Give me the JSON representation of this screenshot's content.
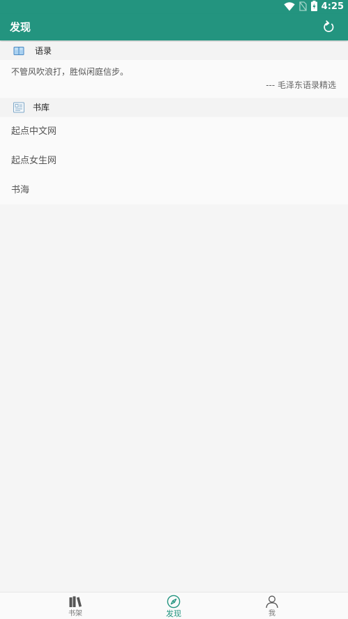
{
  "status_bar": {
    "time": "4:25",
    "icons": [
      "wifi-icon",
      "no-sim-icon",
      "battery-charging-icon"
    ]
  },
  "toolbar": {
    "title": "发现",
    "refresh_icon": "refresh-icon"
  },
  "quotes_section": {
    "label": "语录",
    "icon": "book-open-icon",
    "quote": "不管风吹浪打，胜似闲庭信步。",
    "source": "--- 毛泽东语录精选"
  },
  "library_section": {
    "label": "书库",
    "icon": "library-card-icon",
    "items": [
      "起点中文网",
      "起点女生网",
      "书海"
    ]
  },
  "bottom_nav": {
    "items": [
      {
        "label": "书架",
        "icon": "bookshelf-icon",
        "active": false
      },
      {
        "label": "发现",
        "icon": "compass-icon",
        "active": true
      },
      {
        "label": "我",
        "icon": "person-icon",
        "active": false
      }
    ]
  },
  "colors": {
    "primary": "#23947f",
    "background": "#f5f5f5",
    "card": "#fafafa"
  }
}
